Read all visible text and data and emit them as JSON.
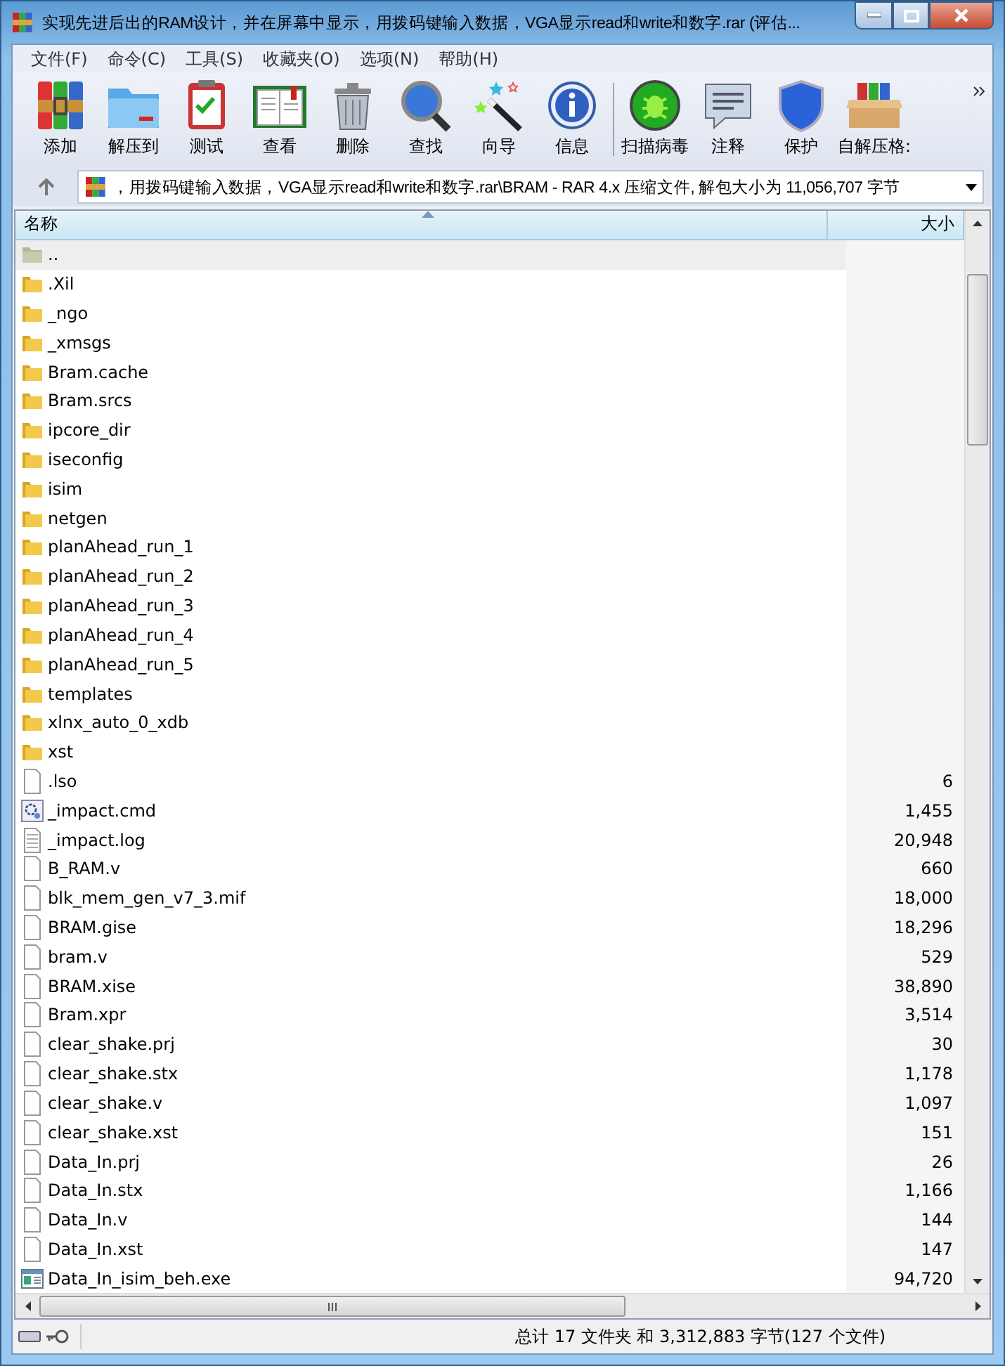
{
  "window": {
    "title": "实现先进后出的RAM设计，并在屏幕中显示，用拨码键输入数据，VGA显示read和write和数字.rar (评估..."
  },
  "menu": [
    "文件(F)",
    "命令(C)",
    "工具(S)",
    "收藏夹(O)",
    "选项(N)",
    "帮助(H)"
  ],
  "toolbar": [
    {
      "kind": "add",
      "label": "添加"
    },
    {
      "kind": "extract",
      "label": "解压到"
    },
    {
      "kind": "test",
      "label": "测试"
    },
    {
      "kind": "view",
      "label": "查看"
    },
    {
      "kind": "delete",
      "label": "删除"
    },
    {
      "kind": "find",
      "label": "查找"
    },
    {
      "kind": "wizard",
      "label": "向导"
    },
    {
      "kind": "info",
      "label": "信息"
    },
    {
      "kind": "scan",
      "label": "扫描病毒"
    },
    {
      "kind": "comment",
      "label": "注释"
    },
    {
      "kind": "protect",
      "label": "保护"
    },
    {
      "kind": "sfx",
      "label": "自解压格:"
    }
  ],
  "address": {
    "path": "，用拨码键输入数据，VGA显示read和write和数字.rar\\BRAM - RAR 4.x 压缩文件, 解包大小为 11,056,707 字节"
  },
  "table": {
    "columns": [
      "名称",
      "大小"
    ],
    "rows": [
      {
        "kind": "parent",
        "name": "..",
        "size": "",
        "selected": true
      },
      {
        "kind": "folder",
        "name": ".Xil",
        "selected": false
      },
      {
        "kind": "folder",
        "name": "_ngo",
        "selected": false
      },
      {
        "kind": "folder",
        "name": "_xmsgs",
        "selected": false
      },
      {
        "kind": "folder",
        "name": "Bram.cache",
        "selected": false
      },
      {
        "kind": "folder",
        "name": "Bram.srcs",
        "selected": false
      },
      {
        "kind": "folder",
        "name": "ipcore_dir",
        "selected": false
      },
      {
        "kind": "folder",
        "name": "iseconfig",
        "selected": false
      },
      {
        "kind": "folder",
        "name": "isim",
        "selected": false
      },
      {
        "kind": "folder",
        "name": "netgen",
        "selected": false
      },
      {
        "kind": "folder",
        "name": "planAhead_run_1",
        "selected": false
      },
      {
        "kind": "folder",
        "name": "planAhead_run_2",
        "selected": false
      },
      {
        "kind": "folder",
        "name": "planAhead_run_3",
        "selected": false
      },
      {
        "kind": "folder",
        "name": "planAhead_run_4",
        "selected": false
      },
      {
        "kind": "folder",
        "name": "planAhead_run_5",
        "selected": false
      },
      {
        "kind": "folder",
        "name": "templates",
        "selected": false
      },
      {
        "kind": "folder",
        "name": "xlnx_auto_0_xdb",
        "selected": false
      },
      {
        "kind": "folder",
        "name": "xst",
        "selected": false
      },
      {
        "kind": "file",
        "name": ".lso",
        "size": "6",
        "selected": false
      },
      {
        "kind": "cmd",
        "name": "_impact.cmd",
        "size": "1,455",
        "selected": false
      },
      {
        "kind": "log",
        "name": "_impact.log",
        "size": "20,948",
        "selected": false
      },
      {
        "kind": "file",
        "name": "B_RAM.v",
        "size": "660",
        "selected": false
      },
      {
        "kind": "file",
        "name": "blk_mem_gen_v7_3.mif",
        "size": "18,000",
        "selected": false
      },
      {
        "kind": "file",
        "name": "BRAM.gise",
        "size": "18,296",
        "selected": false
      },
      {
        "kind": "file",
        "name": "bram.v",
        "size": "529",
        "selected": false
      },
      {
        "kind": "file",
        "name": "BRAM.xise",
        "size": "38,890",
        "selected": false
      },
      {
        "kind": "file",
        "name": "Bram.xpr",
        "size": "3,514",
        "selected": false
      },
      {
        "kind": "file",
        "name": "clear_shake.prj",
        "size": "30",
        "selected": false
      },
      {
        "kind": "file",
        "name": "clear_shake.stx",
        "size": "1,178",
        "selected": false
      },
      {
        "kind": "file",
        "name": "clear_shake.v",
        "size": "1,097",
        "selected": false
      },
      {
        "kind": "file",
        "name": "clear_shake.xst",
        "size": "151",
        "selected": false
      },
      {
        "kind": "file",
        "name": "Data_In.prj",
        "size": "26",
        "selected": false
      },
      {
        "kind": "file",
        "name": "Data_In.stx",
        "size": "1,166",
        "selected": false
      },
      {
        "kind": "file",
        "name": "Data_In.v",
        "size": "144",
        "selected": false
      },
      {
        "kind": "file",
        "name": "Data_In.xst",
        "size": "147",
        "selected": false
      },
      {
        "kind": "exe",
        "name": "Data_In_isim_beh.exe",
        "size": "94,720",
        "selected": false
      }
    ]
  },
  "status_bar": {
    "text": "总计 17 文件夹 和 3,312,883 字节(127 个文件)"
  }
}
